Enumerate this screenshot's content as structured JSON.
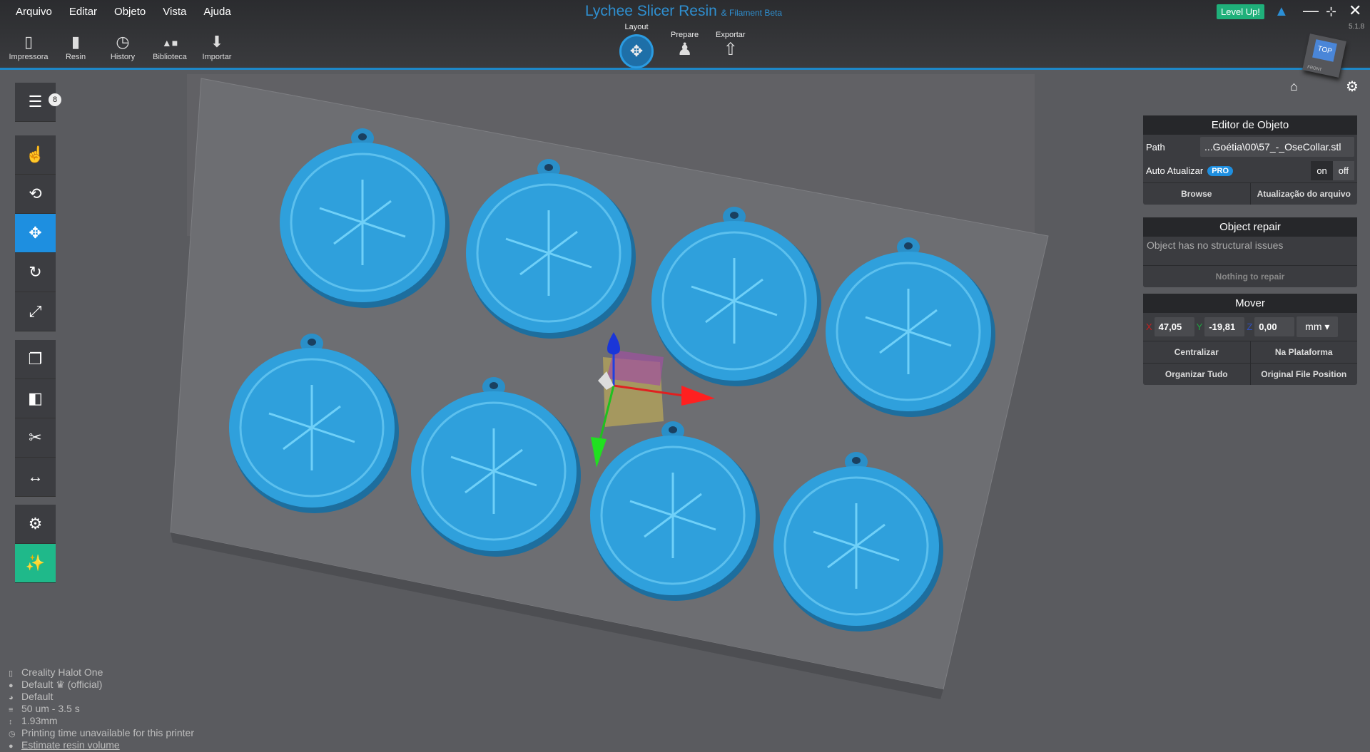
{
  "menu": [
    "Arquivo",
    "Editar",
    "Objeto",
    "Vista",
    "Ajuda"
  ],
  "tools": [
    {
      "label": "Impressora",
      "icon": "📱"
    },
    {
      "label": "Resin",
      "icon": "🧴"
    },
    {
      "label": "History",
      "icon": "🕓"
    },
    {
      "label": "Biblioteca",
      "icon": "▲■"
    },
    {
      "label": "Importar",
      "icon": "⬇"
    }
  ],
  "title": {
    "main": "Lychee Slicer Resin",
    "sub": "& Filament Beta"
  },
  "modes": {
    "layout": "Layout",
    "prepare": "Prepare",
    "export": "Exportar"
  },
  "level_up": "Level Up!",
  "version": "5.1.8",
  "cube": {
    "top": "TOP",
    "front": "FRONT"
  },
  "object_count": "8",
  "editor": {
    "title": "Editor de Objeto",
    "path_label": "Path",
    "path_value": "...Goétia\\00\\57_-_OseCollar.stl",
    "auto_label": "Auto Atualizar",
    "pro": "PRO",
    "on": "on",
    "off": "off",
    "browse": "Browse",
    "update": "Atualização do arquivo"
  },
  "repair": {
    "title": "Object repair",
    "status": "Object has no structural issues",
    "button": "Nothing to repair"
  },
  "mover": {
    "title": "Mover",
    "x_label": "X",
    "x": "47,05",
    "y_label": "Y",
    "y": "-19,81",
    "z_label": "Z",
    "z": "0,00",
    "unit": "mm",
    "centralizar": "Centralizar",
    "plataforma": "Na Plataforma",
    "organizar": "Organizar Tudo",
    "original": "Original File Position"
  },
  "hud": {
    "printer": "Creality Halot One",
    "resin": "Default ♛ (official)",
    "profile": "Default",
    "layer": "50 um - 3.5 s",
    "height": "1.93mm",
    "time": "Printing time unavailable for this printer",
    "estimate": "Estimate resin volume"
  },
  "colors": {
    "accent": "#1e8fe0",
    "model": "#2fa0dc",
    "green": "#1fb98a"
  }
}
